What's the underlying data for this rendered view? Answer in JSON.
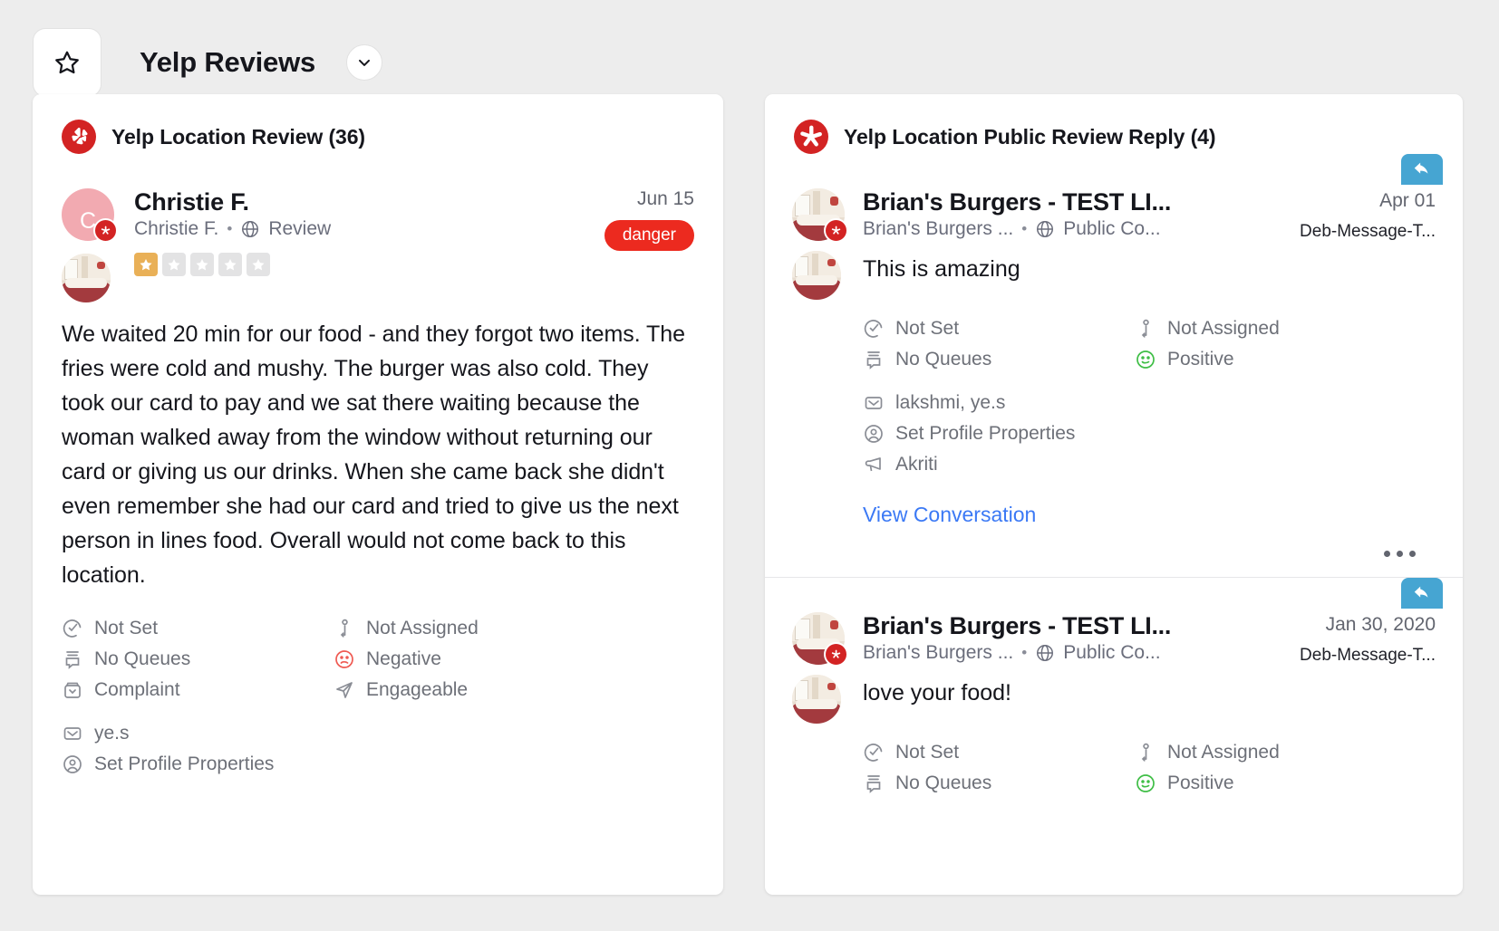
{
  "header": {
    "title": "Yelp Reviews",
    "favorite_icon": "star-icon",
    "expand_icon": "chevron-down-icon"
  },
  "left_card": {
    "title": "Yelp Location Review",
    "count": "(36)",
    "review": {
      "author_name": "Christie F.",
      "author_handle": "Christie F.",
      "separator": "•",
      "channel": "Review",
      "date": "Jun 15",
      "badge": "danger",
      "rating": 1,
      "rating_max": 5,
      "avatar_letter": "C",
      "text": "We waited 20 min for our food - and they forgot two items. The fries were cold and mushy. The burger was also cold. They took our card to pay and we sat there waiting because the woman walked away from the window without returning our card or giving us our drinks. When she came back she didn't even remember she had our card and tried to give us the next person in lines food. Overall would not come back to this location.",
      "meta_left": [
        {
          "icon": "clock-check-icon",
          "label": "Not Set"
        },
        {
          "icon": "queue-icon",
          "label": "No Queues"
        },
        {
          "icon": "inbox-icon",
          "label": "Complaint"
        }
      ],
      "meta_right": [
        {
          "icon": "person-assign-icon",
          "label": "Not Assigned"
        },
        {
          "icon": "frown-icon",
          "label": "Negative"
        },
        {
          "icon": "paper-plane-icon",
          "label": "Engageable"
        }
      ],
      "meta_bottom": [
        {
          "icon": "envelope-icon",
          "label": "ye.s"
        },
        {
          "icon": "user-circle-icon",
          "label": "Set Profile Properties"
        }
      ]
    }
  },
  "right_card": {
    "title": "Yelp Location Public Review Reply",
    "count": "(4)",
    "replies": [
      {
        "author_name": "Brian's Burgers - TEST LI...",
        "author_handle": "Brian's Burgers ...",
        "separator": "•",
        "channel": "Public Co...",
        "date": "Apr 01",
        "tag": "Deb-Message-T...",
        "message": "This is amazing",
        "meta_left": [
          {
            "icon": "clock-check-icon",
            "label": "Not Set"
          },
          {
            "icon": "queue-icon",
            "label": "No Queues"
          }
        ],
        "meta_right": [
          {
            "icon": "person-assign-icon",
            "label": "Not Assigned"
          },
          {
            "icon": "smile-icon",
            "label": "Positive"
          }
        ],
        "meta_bottom": [
          {
            "icon": "envelope-icon",
            "label": "lakshmi, ye.s"
          },
          {
            "icon": "user-circle-icon",
            "label": "Set Profile Properties"
          },
          {
            "icon": "megaphone-icon",
            "label": "Akriti"
          }
        ],
        "view_conversation": "View Conversation",
        "menu_icon": "ellipsis-icon",
        "reply_icon": "reply-arrow-icon"
      },
      {
        "author_name": "Brian's Burgers - TEST LI...",
        "author_handle": "Brian's Burgers ...",
        "separator": "•",
        "channel": "Public Co...",
        "date": "Jan 30, 2020",
        "tag": "Deb-Message-T...",
        "message": "love your food!",
        "meta_left": [
          {
            "icon": "clock-check-icon",
            "label": "Not Set"
          },
          {
            "icon": "queue-icon",
            "label": "No Queues"
          }
        ],
        "meta_right": [
          {
            "icon": "person-assign-icon",
            "label": "Not Assigned"
          },
          {
            "icon": "smile-icon",
            "label": "Positive"
          }
        ],
        "reply_icon": "reply-arrow-icon"
      }
    ]
  },
  "colors": {
    "yelp_red": "#d32323",
    "danger": "#ec2a1f",
    "link_blue": "#3b79f5",
    "reply_blue": "#46a5d2",
    "positive_green": "#3fbe46",
    "negative_red": "#ef5a52",
    "star_on": "#e9b057",
    "star_off": "#e3e3e4",
    "page_bg": "#ededed"
  }
}
